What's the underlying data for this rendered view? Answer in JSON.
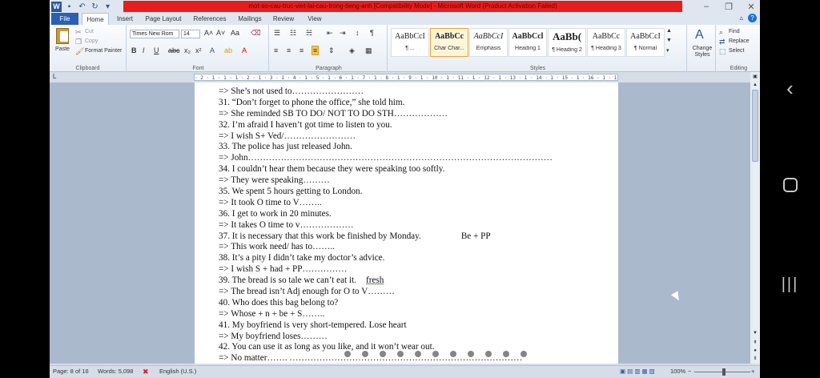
{
  "window": {
    "title": "mot-so-cau-truc-viet-lai-cau-trong-tieng-anh [Compatibility Mode] - Microsoft Word (Product Activation Failed)",
    "accent_color": "#2b579a",
    "title_highlight_color": "#e81d1d"
  },
  "quick_access": [
    "word-icon",
    "save-icon",
    "undo-icon",
    "redo-icon",
    "customize-icon"
  ],
  "tabs": [
    "File",
    "Home",
    "Insert",
    "Page Layout",
    "References",
    "Mailings",
    "Review",
    "View"
  ],
  "active_tab": "Home",
  "ribbon": {
    "clipboard": {
      "paste": "Paste",
      "cut": "Cut",
      "copy": "Copy",
      "format_painter": "Format Painter",
      "label": "Clipboard"
    },
    "font": {
      "name": "Times New Rom",
      "size": "14",
      "label": "Font"
    },
    "paragraph": {
      "label": "Paragraph"
    },
    "styles": {
      "items": [
        {
          "sample": "AaBbCcI",
          "name": "¶ ..."
        },
        {
          "sample": "AaBbCc",
          "name": "Char Char..."
        },
        {
          "sample": "AaBbCcI",
          "name": "Emphasis"
        },
        {
          "sample": "AaBbCcl",
          "name": "Heading 1"
        },
        {
          "sample": "AaBb(",
          "name": "¶ Heading 2"
        },
        {
          "sample": "AaBbCc",
          "name": "¶ Heading 3"
        },
        {
          "sample": "AaBbCcI",
          "name": "¶ Normal"
        }
      ],
      "change_styles": "Change Styles",
      "label": "Styles"
    },
    "editing": {
      "find": "Find",
      "replace": "Replace",
      "select": "Select",
      "label": "Editing"
    }
  },
  "ruler_text": "· 2 · 1 · 1 · 1 · 2 · 1 · 3 · 1 · 4 · 1 · 5 · 1 · 6 · 1 · 7 · 1 · 8 · 1 · 9 · 1 · 10 · 1 · 11 · 1 · 12 · 1 · 13 · 1 · 14 · 1 · 15 · 1 · 16 · 1 · 17 · 1 · 18 · 1 · 19 · 1 ·20·",
  "document": {
    "lines": [
      "=> She’s not used to……………………",
      "31. “Don’t forget to phone the office,” she told him.",
      "=> She reminded SB TO DO/ NOT TO DO STH………………",
      "32. I’m afraid I haven’t got time to listen to you.",
      "=> I wish S+ Ved/……………………",
      "33. The police has just released John.",
      "=> John…………………………………………………………………………………………",
      "34. I couldn’t hear them because they were speaking too softly.",
      "=> They were speaking………",
      "35. We spent 5 hours getting to London.",
      "=> It took O time to V……..",
      "36. I get to work in 20 minutes.",
      "=> It takes O time to v………………",
      "37. It is necessary that this work be finished by Monday.",
      "=> This work need/ has to……..",
      "38. It’s a pity I didn’t take my doctor’s advice.",
      "=> I wish S + had + PP……………",
      "39. The bread is so tale we can’t eat it.",
      "=> The bread isn’t Adj enough for O to V………",
      "40. Who does this bag belong to?",
      "=> Whose + n + be + S……..",
      "41. My boyfriend is very short-tempered. Lose heart",
      "=> My boyfriend loses………",
      "42. You can use it as long as you like, and it won’t wear out.",
      "=> No matter……. ……………………………………………………………………"
    ],
    "note_37": "Be + PP",
    "note_39": "fresh"
  },
  "status": {
    "page": "Page: 8 of 16",
    "words": "Words: 5,098",
    "language": "English (U.S.)",
    "zoom": "100%"
  },
  "android_nav": [
    "back-icon",
    "home-icon",
    "recent-apps-icon"
  ]
}
